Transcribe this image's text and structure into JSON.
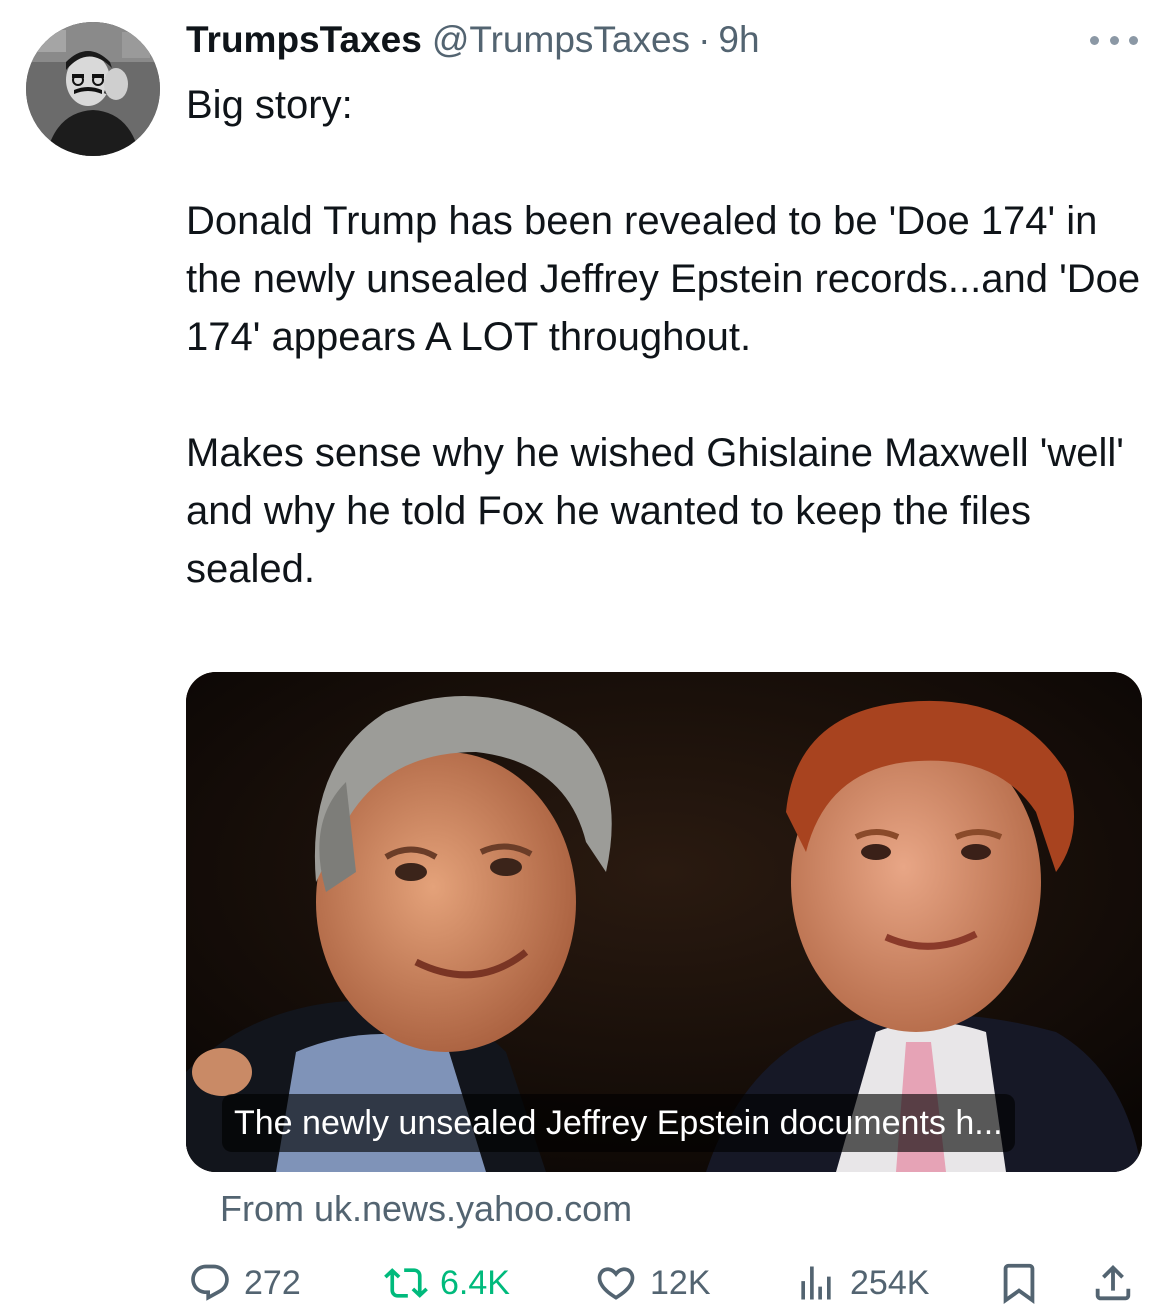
{
  "author": {
    "display_name": "TrumpsTaxes",
    "handle": "@TrumpsTaxes",
    "separator": "·",
    "time": "9h"
  },
  "tweet": {
    "paragraphs": [
      "Big story:",
      "Donald Trump has been revealed to be 'Doe 174' in the newly unsealed Jeffrey Epstein records...and 'Doe 174' appears A LOT throughout.",
      "Makes sense why he wished Ghislaine Maxwell 'well' and why he told Fox he wanted to keep the files sealed."
    ]
  },
  "link_card": {
    "caption": "The newly unsealed Jeffrey Epstein documents h...",
    "source": "From uk.news.yahoo.com"
  },
  "actions": {
    "replies": "272",
    "retweets": "6.4K",
    "likes": "12K",
    "views": "254K"
  },
  "colors": {
    "text": "#0f1419",
    "secondary": "#536471",
    "retweet_active": "#00ba7c"
  },
  "icons": [
    "more-icon",
    "reply-icon",
    "retweet-icon",
    "like-icon",
    "views-icon",
    "bookmark-icon",
    "share-icon"
  ]
}
